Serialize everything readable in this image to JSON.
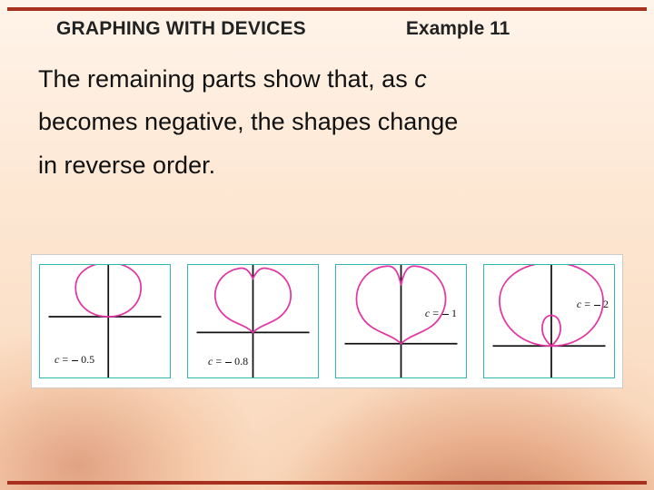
{
  "header": {
    "title": "GRAPHING WITH DEVICES",
    "example": "Example 11"
  },
  "body": {
    "line1a": "The remaining parts show that, as ",
    "line1b": "c",
    "line2": "becomes negative, the shapes change",
    "line3": "in reverse order."
  },
  "panels": [
    {
      "c_text": "0.5"
    },
    {
      "c_text": "0.8"
    },
    {
      "c_text": "1"
    },
    {
      "c_text": "2"
    }
  ],
  "label_prefix": "c",
  "label_eq": "="
}
